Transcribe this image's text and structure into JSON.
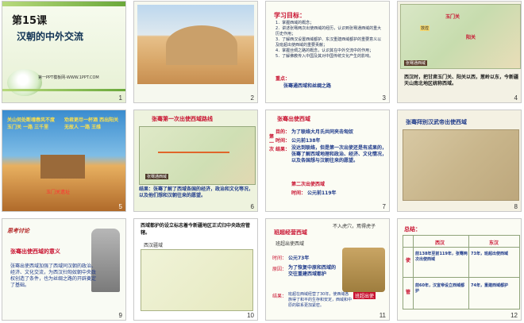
{
  "slides": [
    {
      "num": "1",
      "title": "第15课",
      "subtitle": "汉朝的中外交流",
      "site": "第一PPT模板网-WWW.1PPT.COM"
    },
    {
      "num": "2"
    },
    {
      "num": "3",
      "heading": "学习目标：",
      "items": [
        "1．掌握西域的概念；",
        "2．讲述张骞两次出使西域的经历，认识到张骞通西域的重大历史作用；",
        "3．了解西汉设置西域都护、东汉重建西域都护的重要意义以及班超出使西域的重要贡献；",
        "4．掌握丝绸之路的概念，认识其在中外交流中的作用；",
        "5．了解佛教传入中国及其对中国传统文化产生的影响。"
      ],
      "key_label": "重点：",
      "key_text": "张骞通西域和丝绸之路"
    },
    {
      "num": "4",
      "map_labels": [
        "玉门关",
        "阳关",
        "敦煌",
        "张骞通西域"
      ],
      "caption": "西汉时，把甘肃玉门关、阳关以西，葱岭以东，今新疆天山南北地区统称西域。"
    },
    {
      "num": "5",
      "poem_left": "关山何处断魂春风不度玉门关 一路 三千里",
      "poem_right": "劝君更尽一杯酒 西出阳关无故人 一路 王维",
      "gate_label": "玉门关遗址"
    },
    {
      "num": "6",
      "title": "张骞第一次出使西域路线",
      "map_label": "张骞通西域",
      "conclusion": "结果：张骞了解了西域各国的经济，政治和文化等况，以及他们想和汉朝往来的愿望。"
    },
    {
      "num": "7",
      "header": "张骞出使西域",
      "first_label": "第一次",
      "goal_label": "目的：",
      "goal": "为了联络大月氏共同夹击匈奴",
      "time_label": "时间：",
      "time": "公元前138年",
      "result_label": "结果：",
      "result": "没达到联络，但是第一次出使还是有成果的，张骞了解西域地理和政治、经济、文化情况，以及各国想与汉朝往来的愿望。",
      "second_label": "第二次出使西域",
      "second_time_label": "时间：",
      "second_time": "公元前119年"
    },
    {
      "num": "8",
      "title": "张骞拜别汉武帝出使西域"
    },
    {
      "num": "9",
      "discuss": "思考讨论",
      "question": "张骞出使西域的意义",
      "answer": "张骞出使西域加强了西域同汉朝的政治、经济、文化交流，为西汉扫匈奴朝中央政权创造了条件，也为丝绸之路的开辟奠定了基础。"
    },
    {
      "num": "10",
      "header": "西域都护的设立标志着今新疆地区正式归中央政府管辖。",
      "map_title": "西汉疆域"
    },
    {
      "num": "11",
      "top_right": "不入虎穴，焉得虎子",
      "title": "班超经营西域",
      "sub": "班超出使西域",
      "time_label": "时间：",
      "time": "公元73年",
      "reason_label": "原因：",
      "reason": "为了恢复中原和西域的交往重建西域都护",
      "result_label": "结果：",
      "result": "班超在西域经营了30年，使西域各族得了和平的生存和安定，西域和中原的联系更加紧密。",
      "badge": "班超出使"
    },
    {
      "num": "12",
      "title": "总结：",
      "col_west": "西汉",
      "col_east": "东汉",
      "row1_label": "使",
      "row1_west": "前138年至前119年，张骞两次出使西域",
      "row1_east": "73年，班超出使西域",
      "row2_label": "管",
      "row2_west": "前60年，汉宣帝设立西域都护",
      "row2_east": "74年，重建西域都护"
    }
  ]
}
